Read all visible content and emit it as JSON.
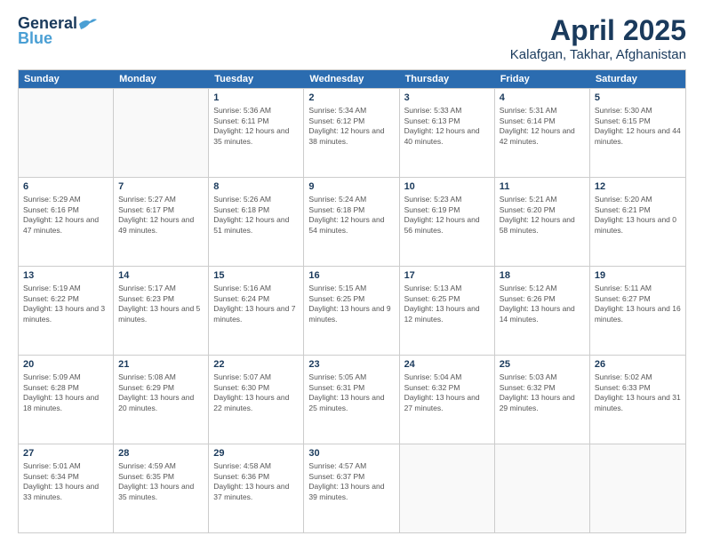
{
  "header": {
    "logo_general": "General",
    "logo_blue": "Blue",
    "title": "April 2025",
    "subtitle": "Kalafgan, Takhar, Afghanistan"
  },
  "calendar": {
    "days_of_week": [
      "Sunday",
      "Monday",
      "Tuesday",
      "Wednesday",
      "Thursday",
      "Friday",
      "Saturday"
    ],
    "weeks": [
      [
        {
          "day": "",
          "info": ""
        },
        {
          "day": "",
          "info": ""
        },
        {
          "day": "1",
          "info": "Sunrise: 5:36 AM\nSunset: 6:11 PM\nDaylight: 12 hours and 35 minutes."
        },
        {
          "day": "2",
          "info": "Sunrise: 5:34 AM\nSunset: 6:12 PM\nDaylight: 12 hours and 38 minutes."
        },
        {
          "day": "3",
          "info": "Sunrise: 5:33 AM\nSunset: 6:13 PM\nDaylight: 12 hours and 40 minutes."
        },
        {
          "day": "4",
          "info": "Sunrise: 5:31 AM\nSunset: 6:14 PM\nDaylight: 12 hours and 42 minutes."
        },
        {
          "day": "5",
          "info": "Sunrise: 5:30 AM\nSunset: 6:15 PM\nDaylight: 12 hours and 44 minutes."
        }
      ],
      [
        {
          "day": "6",
          "info": "Sunrise: 5:29 AM\nSunset: 6:16 PM\nDaylight: 12 hours and 47 minutes."
        },
        {
          "day": "7",
          "info": "Sunrise: 5:27 AM\nSunset: 6:17 PM\nDaylight: 12 hours and 49 minutes."
        },
        {
          "day": "8",
          "info": "Sunrise: 5:26 AM\nSunset: 6:18 PM\nDaylight: 12 hours and 51 minutes."
        },
        {
          "day": "9",
          "info": "Sunrise: 5:24 AM\nSunset: 6:18 PM\nDaylight: 12 hours and 54 minutes."
        },
        {
          "day": "10",
          "info": "Sunrise: 5:23 AM\nSunset: 6:19 PM\nDaylight: 12 hours and 56 minutes."
        },
        {
          "day": "11",
          "info": "Sunrise: 5:21 AM\nSunset: 6:20 PM\nDaylight: 12 hours and 58 minutes."
        },
        {
          "day": "12",
          "info": "Sunrise: 5:20 AM\nSunset: 6:21 PM\nDaylight: 13 hours and 0 minutes."
        }
      ],
      [
        {
          "day": "13",
          "info": "Sunrise: 5:19 AM\nSunset: 6:22 PM\nDaylight: 13 hours and 3 minutes."
        },
        {
          "day": "14",
          "info": "Sunrise: 5:17 AM\nSunset: 6:23 PM\nDaylight: 13 hours and 5 minutes."
        },
        {
          "day": "15",
          "info": "Sunrise: 5:16 AM\nSunset: 6:24 PM\nDaylight: 13 hours and 7 minutes."
        },
        {
          "day": "16",
          "info": "Sunrise: 5:15 AM\nSunset: 6:25 PM\nDaylight: 13 hours and 9 minutes."
        },
        {
          "day": "17",
          "info": "Sunrise: 5:13 AM\nSunset: 6:25 PM\nDaylight: 13 hours and 12 minutes."
        },
        {
          "day": "18",
          "info": "Sunrise: 5:12 AM\nSunset: 6:26 PM\nDaylight: 13 hours and 14 minutes."
        },
        {
          "day": "19",
          "info": "Sunrise: 5:11 AM\nSunset: 6:27 PM\nDaylight: 13 hours and 16 minutes."
        }
      ],
      [
        {
          "day": "20",
          "info": "Sunrise: 5:09 AM\nSunset: 6:28 PM\nDaylight: 13 hours and 18 minutes."
        },
        {
          "day": "21",
          "info": "Sunrise: 5:08 AM\nSunset: 6:29 PM\nDaylight: 13 hours and 20 minutes."
        },
        {
          "day": "22",
          "info": "Sunrise: 5:07 AM\nSunset: 6:30 PM\nDaylight: 13 hours and 22 minutes."
        },
        {
          "day": "23",
          "info": "Sunrise: 5:05 AM\nSunset: 6:31 PM\nDaylight: 13 hours and 25 minutes."
        },
        {
          "day": "24",
          "info": "Sunrise: 5:04 AM\nSunset: 6:32 PM\nDaylight: 13 hours and 27 minutes."
        },
        {
          "day": "25",
          "info": "Sunrise: 5:03 AM\nSunset: 6:32 PM\nDaylight: 13 hours and 29 minutes."
        },
        {
          "day": "26",
          "info": "Sunrise: 5:02 AM\nSunset: 6:33 PM\nDaylight: 13 hours and 31 minutes."
        }
      ],
      [
        {
          "day": "27",
          "info": "Sunrise: 5:01 AM\nSunset: 6:34 PM\nDaylight: 13 hours and 33 minutes."
        },
        {
          "day": "28",
          "info": "Sunrise: 4:59 AM\nSunset: 6:35 PM\nDaylight: 13 hours and 35 minutes."
        },
        {
          "day": "29",
          "info": "Sunrise: 4:58 AM\nSunset: 6:36 PM\nDaylight: 13 hours and 37 minutes."
        },
        {
          "day": "30",
          "info": "Sunrise: 4:57 AM\nSunset: 6:37 PM\nDaylight: 13 hours and 39 minutes."
        },
        {
          "day": "",
          "info": ""
        },
        {
          "day": "",
          "info": ""
        },
        {
          "day": "",
          "info": ""
        }
      ]
    ]
  }
}
